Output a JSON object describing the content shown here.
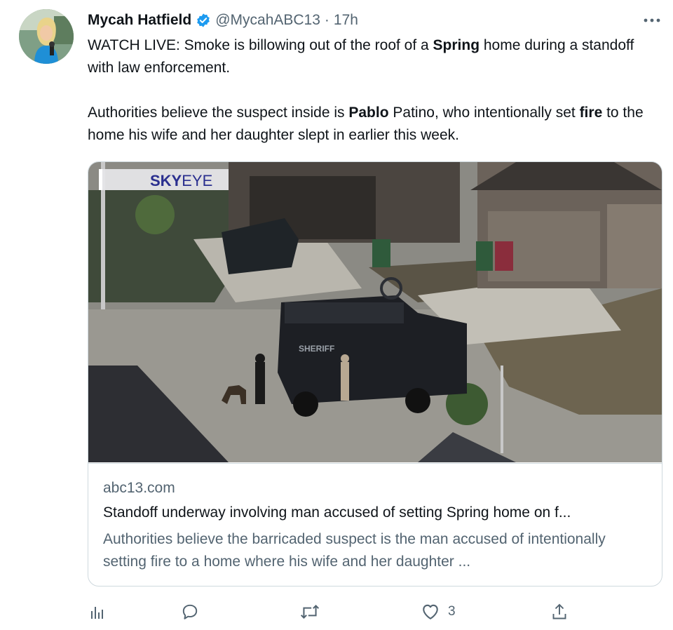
{
  "author": {
    "name": "Mycah Hatfield",
    "handle": "@MycahABC13",
    "separator": "·",
    "time": "17h"
  },
  "tweet": {
    "p1_a": "WATCH LIVE: Smoke is billowing out of the roof of a ",
    "p1_b": "Spring",
    "p1_c": " home during a standoff with law enforcement.",
    "p2_a": "Authorities believe the suspect inside is ",
    "p2_b": "Pablo",
    "p2_c": " Patino, who intentionally set ",
    "p2_d": "fire",
    "p2_e": " to the home his wife and her daughter slept in earlier this week."
  },
  "card": {
    "overlay_sky": "SKY",
    "overlay_eye": "EYE",
    "vehicle_text": "SHERIFF",
    "domain": "abc13.com",
    "title": "Standoff underway involving man accused of setting Spring home on f...",
    "description": "Authorities believe the barricaded suspect is the man accused of intentionally setting fire to a home where his wife and her daughter ..."
  },
  "actions": {
    "like_count": "3"
  },
  "icons": {
    "verified": "verified-badge-icon",
    "more": "more-dots-icon",
    "analytics": "analytics-icon",
    "reply": "reply-icon",
    "retweet": "retweet-icon",
    "like": "heart-icon",
    "share": "share-icon"
  },
  "colors": {
    "verified": "#1d9bf0",
    "text_secondary": "#536471",
    "border": "#cfd9de",
    "skyeye_blue": "#2a2f8f"
  }
}
